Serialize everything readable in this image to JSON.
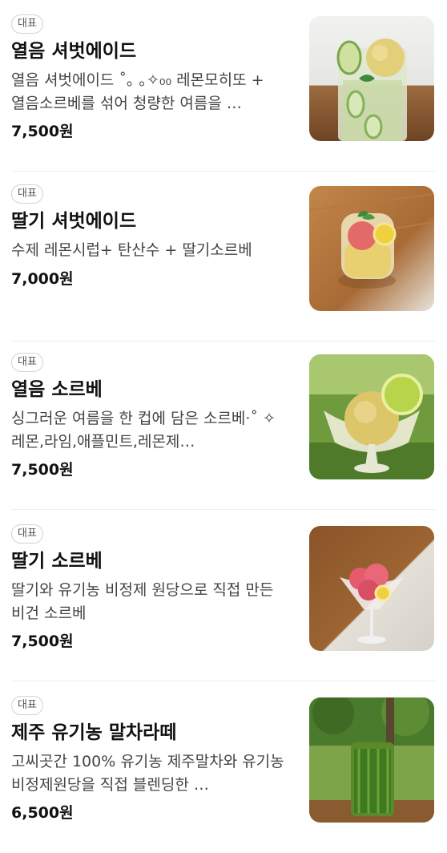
{
  "menu": {
    "items": [
      {
        "badge": "대표",
        "name": "열음 셔벗에이드",
        "description": "열음 셔벗에이드 ˚｡ ｡✧₀₀ 레몬모히또 + 열음소르베를 섞어 청량한 여름을 …",
        "price": "7,500원",
        "image": "photo-sherbet-ade"
      },
      {
        "badge": "대표",
        "name": "딸기 셔벗에이드",
        "description": "수제 레몬시럽+ 탄산수 + 딸기소르베",
        "price": "7,000원",
        "image": "photo-strawberry-sherbet-ade"
      },
      {
        "badge": "대표",
        "name": "열음 소르베",
        "description": "싱그러운 여름을 한 컵에 담은 소르베·˚ ✧ 레몬,라임,애플민트,레몬제…",
        "price": "7,500원",
        "image": "photo-sorbet"
      },
      {
        "badge": "대표",
        "name": "딸기 소르베",
        "description": "딸기와 유기농 비정제 원당으로 직접 만든 비건 소르베",
        "price": "7,500원",
        "image": "photo-strawberry-sorbet"
      },
      {
        "badge": "대표",
        "name": "제주 유기농 말차라떼",
        "description": "고씨곳간 100% 유기농 제주말차와 유기농 비정제원당을 직접 블렌딩한 …",
        "price": "6,500원",
        "image": "photo-matcha-latte"
      }
    ]
  }
}
